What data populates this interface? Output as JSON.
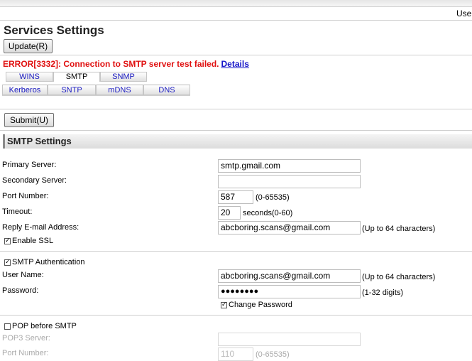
{
  "header": {
    "user_label": "User"
  },
  "page": {
    "title": "Services Settings",
    "update_button": "Update(R)"
  },
  "error": {
    "message": "ERROR[3332]: Connection to SMTP server test failed.",
    "details_link": "Details"
  },
  "tabs": {
    "row1": [
      {
        "label": "WINS"
      },
      {
        "label": "SMTP"
      },
      {
        "label": "SNMP"
      }
    ],
    "row2": [
      {
        "label": "Kerberos"
      },
      {
        "label": "SNTP"
      },
      {
        "label": "mDNS"
      },
      {
        "label": "DNS"
      }
    ],
    "active": "SMTP"
  },
  "submit_button": "Submit(U)",
  "section": {
    "title": "SMTP Settings"
  },
  "smtp": {
    "primary_server": {
      "label": "Primary Server:",
      "value": "smtp.gmail.com"
    },
    "secondary_server": {
      "label": "Secondary Server:",
      "value": ""
    },
    "port": {
      "label": "Port Number:",
      "value": "587",
      "hint": "(0-65535)"
    },
    "timeout": {
      "label": "Timeout:",
      "value": "20",
      "hint": "seconds(0-60)"
    },
    "reply_email": {
      "label": "Reply E-mail Address:",
      "value": "abcboring.scans@gmail.com",
      "hint": "(Up to 64 characters)"
    },
    "enable_ssl": {
      "label": "Enable SSL",
      "checked": true
    }
  },
  "auth": {
    "smtp_auth": {
      "label": "SMTP Authentication",
      "checked": true
    },
    "user_name": {
      "label": "User Name:",
      "value": "abcboring.scans@gmail.com",
      "hint": "(Up to 64 characters)"
    },
    "password": {
      "label": "Password:",
      "value": "●●●●●●●●",
      "hint": "(1-32 digits)"
    },
    "change_password": {
      "label": "Change Password",
      "checked": true
    }
  },
  "pop": {
    "pop_before_smtp": {
      "label": "POP before SMTP",
      "checked": false
    },
    "pop3_server": {
      "label": "POP3 Server:",
      "value": ""
    },
    "port": {
      "label": "Port Number:",
      "value": "110",
      "hint": "(0-65535)"
    }
  }
}
